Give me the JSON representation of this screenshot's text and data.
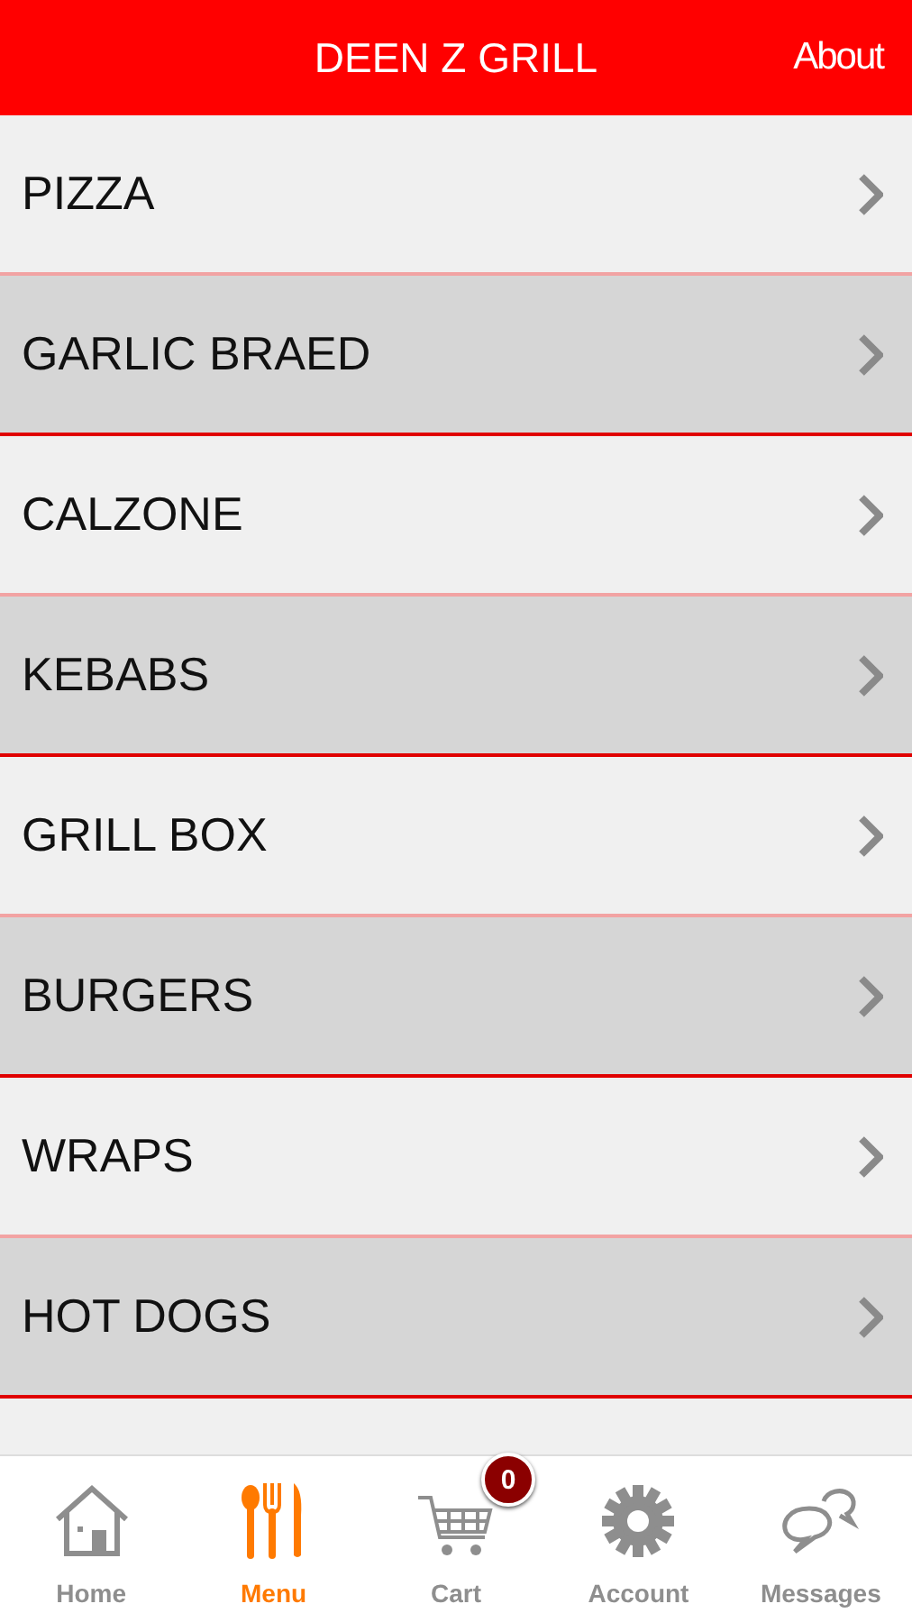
{
  "header": {
    "title": "DEEN Z GRILL",
    "action": "About"
  },
  "menu_items": [
    "PIZZA",
    "GARLIC BRAED",
    "CALZONE",
    "KEBABS",
    "GRILL BOX",
    "BURGERS",
    "WRAPS",
    "HOT DOGS"
  ],
  "tab_bar": [
    {
      "kind": "home",
      "label": "Home",
      "selected": false
    },
    {
      "kind": "menu",
      "label": "Menu",
      "selected": true
    },
    {
      "kind": "cart",
      "label": "Cart",
      "selected": false,
      "badge": "0"
    },
    {
      "kind": "account",
      "label": "Account",
      "selected": false
    },
    {
      "kind": "messages",
      "label": "Messages",
      "selected": false
    }
  ]
}
